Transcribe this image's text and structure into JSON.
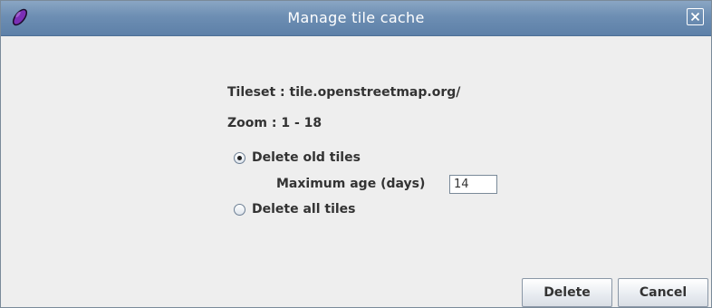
{
  "window": {
    "title": "Manage tile cache",
    "icon": "purple-oval-icon",
    "close_icon": "close-icon"
  },
  "info": {
    "tileset": "Tileset : tile.openstreetmap.org/",
    "zoom": "Zoom : 1 - 18"
  },
  "options": {
    "delete_old_label": "Delete old tiles",
    "delete_old_checked": true,
    "max_age_label": "Maximum age (days)",
    "max_age_value": "14",
    "delete_all_label": "Delete all tiles",
    "delete_all_checked": false
  },
  "buttons": {
    "delete_label": "Delete",
    "cancel_label": "Cancel"
  },
  "colors": {
    "titlebar": "#6d8eb3",
    "window_bg": "#eeeeee",
    "icon_purple": "#7b2fb5"
  }
}
